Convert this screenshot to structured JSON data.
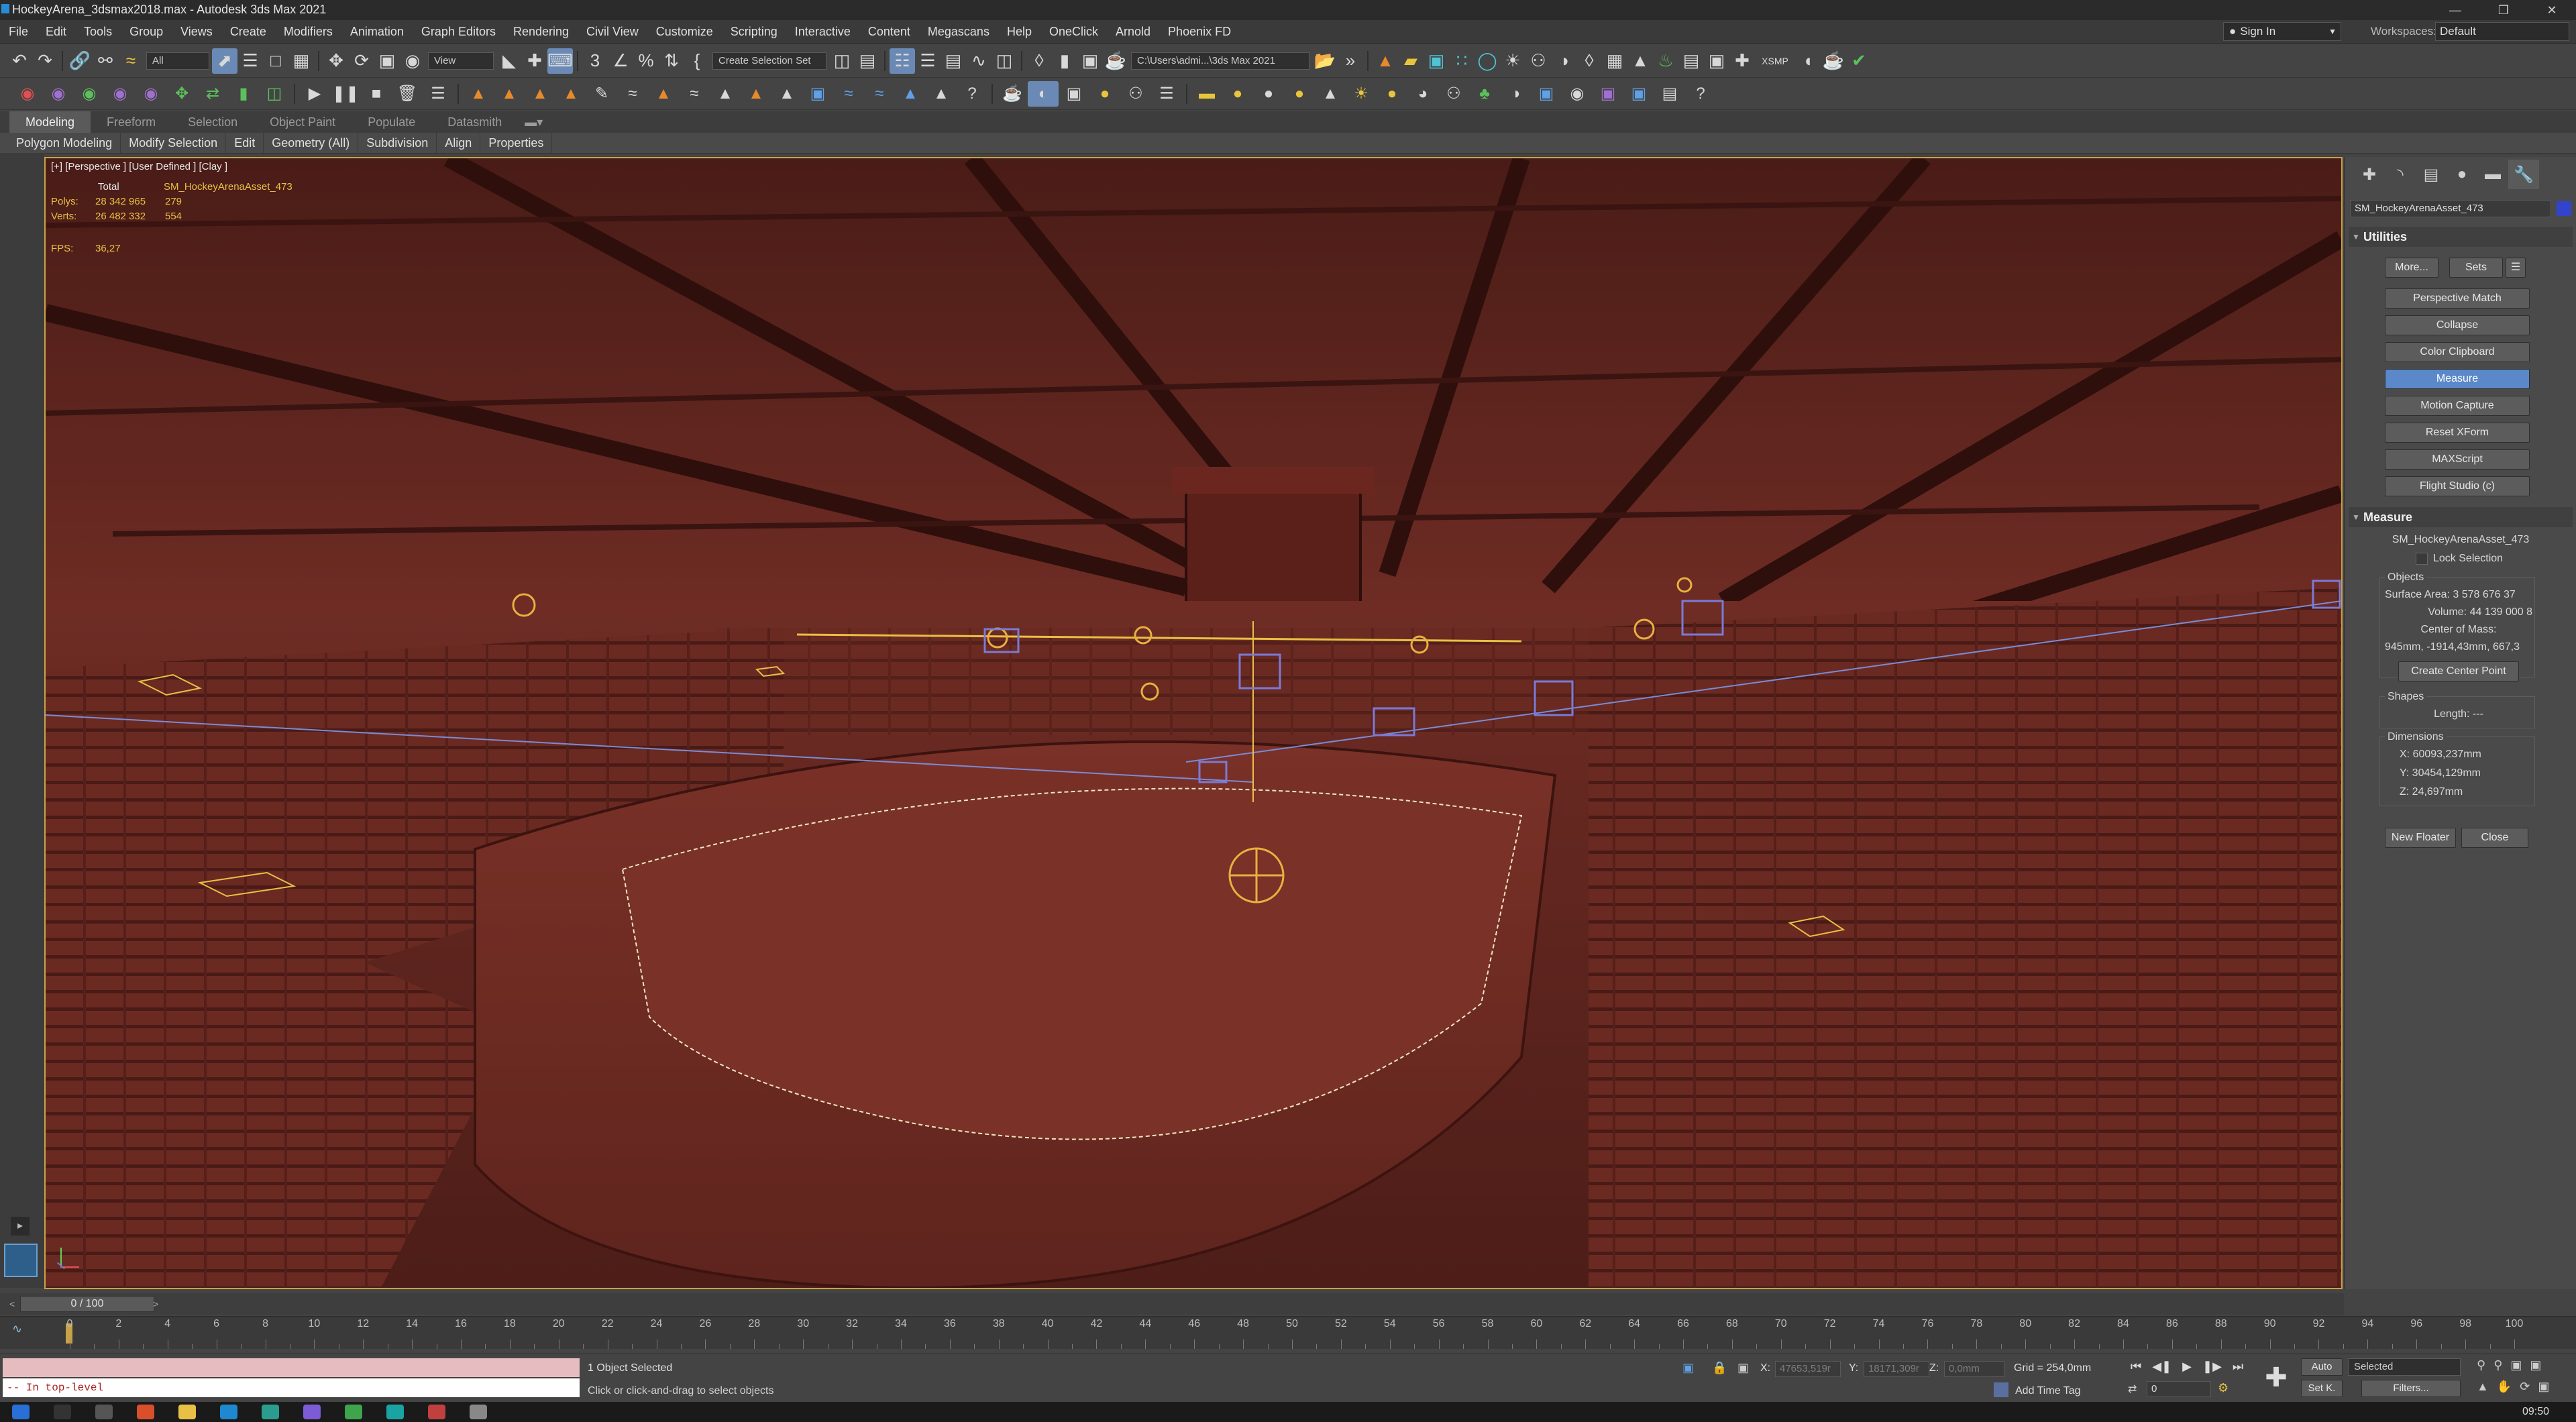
{
  "titlebar": {
    "title": "HockeyArena_3dsmax2018.max - Autodesk 3ds Max 2021",
    "controls": [
      "minimize",
      "maximize",
      "close"
    ]
  },
  "menu": {
    "items": [
      "File",
      "Edit",
      "Tools",
      "Group",
      "Views",
      "Create",
      "Modifiers",
      "Animation",
      "Graph Editors",
      "Rendering",
      "Civil View",
      "Customize",
      "Scripting",
      "Interactive",
      "Content",
      "Megascans",
      "Help",
      "OneClick",
      "Arnold",
      "Phoenix FD"
    ],
    "sign_in": "Sign In",
    "workspaces_label": "Workspaces:",
    "workspace_value": "Default"
  },
  "toolbar": {
    "selection_filter": "All",
    "ref_coord": "View",
    "selection_set": "Create Selection Set",
    "project_path": "C:\\Users\\admi...\\3ds Max 2021",
    "xsmp_label": "XSMP"
  },
  "ribbon": {
    "tabs": [
      "Modeling",
      "Freeform",
      "Selection",
      "Object Paint",
      "Populate",
      "Datasmith"
    ],
    "panels": [
      "Polygon Modeling",
      "Modify Selection",
      "Edit",
      "Geometry (All)",
      "Subdivision",
      "Align",
      "Properties"
    ]
  },
  "viewport": {
    "label": "[+] [Perspective ] [User Defined ] [Clay ]",
    "stats": {
      "total_header": "Total",
      "object_header": "SM_HockeyArenaAsset_473",
      "polys_label": "Polys:",
      "polys_total": "28 342 965",
      "polys_obj": "279",
      "verts_label": "Verts:",
      "verts_total": "26 482 332",
      "verts_obj": "554",
      "fps_label": "FPS:",
      "fps_value": "36,27"
    }
  },
  "command_panel": {
    "object_name": "SM_HockeyArenaAsset_473",
    "object_color": "#3344cc",
    "utilities_title": "Utilities",
    "more_button": "More...",
    "sets_button": "Sets",
    "utility_buttons": [
      "Perspective Match",
      "Collapse",
      "Color Clipboard",
      "Measure",
      "Motion Capture",
      "Reset XForm",
      "MAXScript",
      "Flight Studio (c)"
    ],
    "active_utility": "Measure",
    "measure": {
      "title": "Measure",
      "object": "SM_HockeyArenaAsset_473",
      "lock_selection": "Lock Selection",
      "objects_label": "Objects",
      "surface_area": "Surface Area:  3 578 676 37",
      "volume": "Volume:  44 139 000 8",
      "center_of_mass_label": "Center of Mass:",
      "center_of_mass_value": "945mm, -1914,43mm, 667,3",
      "create_center_point": "Create Center Point",
      "shapes_label": "Shapes",
      "length": "Length:  ---",
      "dimensions_label": "Dimensions",
      "dim_x": "X:  60093,237mm",
      "dim_y": "Y:  30454,129mm",
      "dim_z": "Z:  24,697mm",
      "new_floater": "New Floater",
      "close": "Close"
    }
  },
  "timeline": {
    "frame_display": "0 / 100",
    "ticks": [
      "0",
      "2",
      "4",
      "6",
      "8",
      "10",
      "12",
      "14",
      "16",
      "18",
      "20",
      "22",
      "24",
      "26",
      "28",
      "30",
      "32",
      "34",
      "36",
      "38",
      "40",
      "42",
      "44",
      "46",
      "48",
      "50",
      "52",
      "54",
      "56",
      "58",
      "60",
      "62",
      "64",
      "66",
      "68",
      "70",
      "72",
      "74",
      "76",
      "78",
      "80",
      "82",
      "84",
      "86",
      "88",
      "90",
      "92",
      "94",
      "96",
      "98",
      "100"
    ]
  },
  "status": {
    "listener_prompt": "-- In top-level",
    "selection_status": "1 Object Selected",
    "prompt": "Click or click-and-drag to select objects",
    "x_label": "X:",
    "x_value": "47653,519r",
    "y_label": "Y:",
    "y_value": "18171,309r",
    "z_label": "Z:",
    "z_value": "0,0mm",
    "grid": "Grid = 254,0mm",
    "add_time_tag": "Add Time Tag",
    "auto_key": "Auto",
    "set_key": "Set K.",
    "key_filter": "Selected",
    "filters": "Filters...",
    "frame_field": "0"
  },
  "taskbar": {
    "clock": "09:50"
  }
}
